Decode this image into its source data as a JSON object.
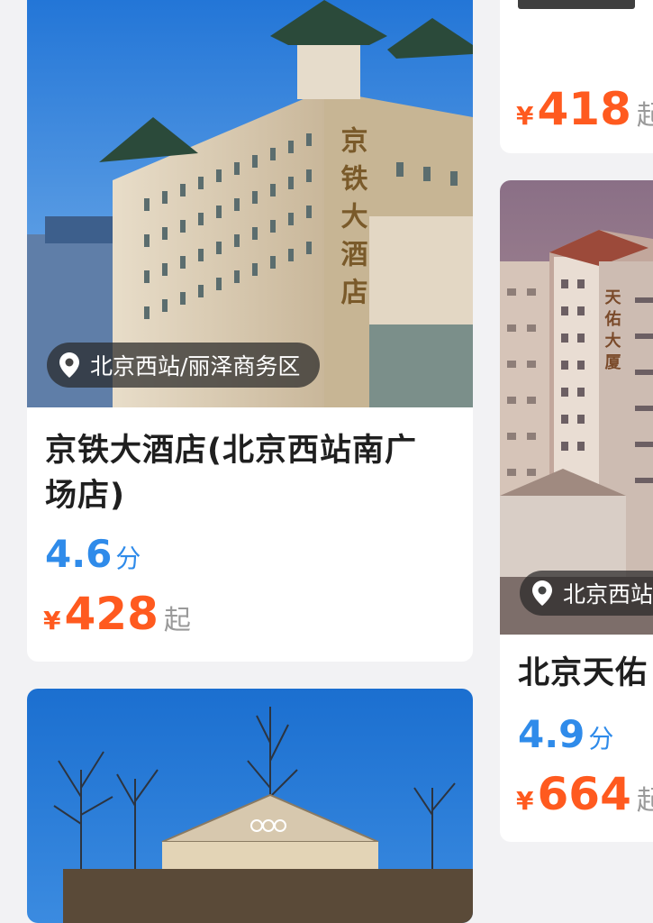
{
  "left_column": {
    "card1": {
      "location": "北京西站/丽泽商务区",
      "name": "京铁大酒店(北京西站南广场店)",
      "rating": "4.6",
      "rating_unit": "分",
      "currency": "¥",
      "price": "428",
      "price_suffix": "起",
      "sign_text": "京铁大酒店"
    }
  },
  "right_column": {
    "card_top": {
      "currency": "¥",
      "price": "418",
      "price_suffix": "起"
    },
    "card2": {
      "location": "北京西站",
      "name": "北京天佑",
      "rating": "4.9",
      "rating_unit": "分",
      "currency": "¥",
      "price": "664",
      "price_suffix": "起",
      "sign_text": "天佑大厦"
    }
  },
  "colors": {
    "price": "#ff5a1f",
    "rating": "#2f8bea",
    "background": "#f2f2f4"
  },
  "icons": [
    "location-pin-icon"
  ]
}
